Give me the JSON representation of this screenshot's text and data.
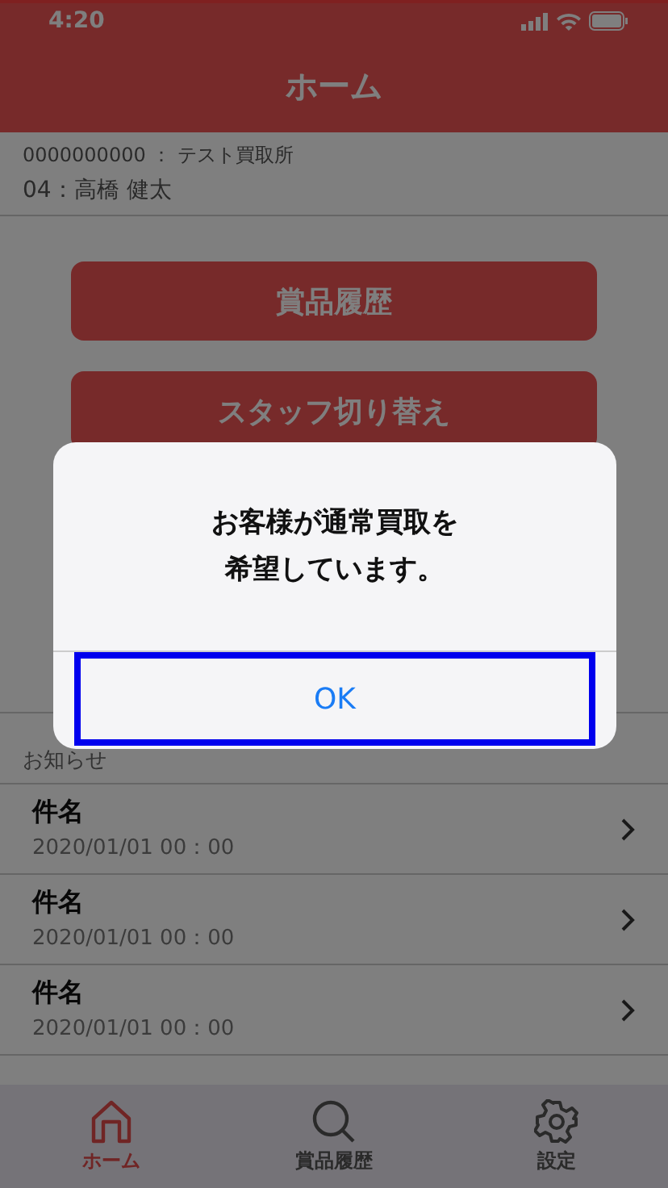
{
  "status_bar": {
    "time": "4:20"
  },
  "nav": {
    "title": "ホーム"
  },
  "account": {
    "store": "0000000000 ： テスト買取所",
    "staff": "04：高橋 健太"
  },
  "actions": [
    "賞品履歴",
    "スタッフ切り替え"
  ],
  "notices": {
    "heading": "お知らせ",
    "items": [
      {
        "title": "件名",
        "date": "2020/01/01 00：00"
      },
      {
        "title": "件名",
        "date": "2020/01/01 00：00"
      },
      {
        "title": "件名",
        "date": "2020/01/01 00：00"
      }
    ]
  },
  "tab_bar": [
    {
      "label": "ホーム",
      "kind": "home",
      "selected": true
    },
    {
      "label": "賞品履歴",
      "kind": "search",
      "selected": false
    },
    {
      "label": "設定",
      "kind": "settings",
      "selected": false
    }
  ],
  "alert": {
    "message_lines": [
      "お客様が通常買取を",
      "希望しています。"
    ],
    "button": "OK",
    "highlighted": true
  }
}
